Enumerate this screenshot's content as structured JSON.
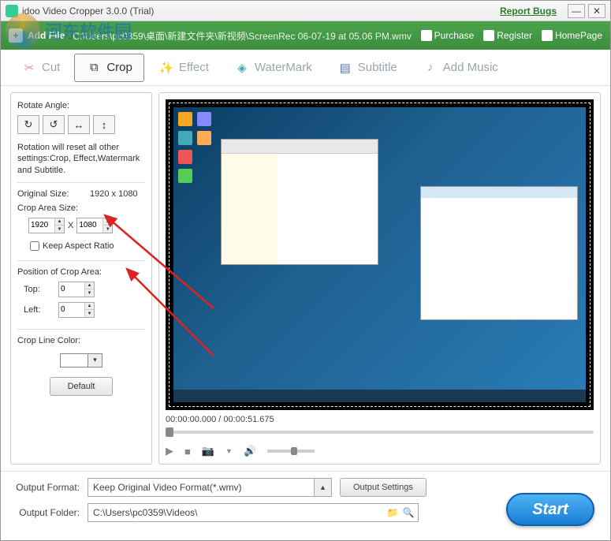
{
  "titlebar": {
    "app_title": "idoo Video Cropper 3.0.0 (Trial)",
    "report_bugs": "Report Bugs"
  },
  "addfile": {
    "add_label": "Add File",
    "path": "C:\\Users\\pc0359\\桌面\\新建文件夹\\新视频\\ScreenRec 06-07-19 at 05.06 PM.wmv",
    "purchase": "Purchase",
    "register": "Register",
    "homepage": "HomePage"
  },
  "tabs": {
    "cut": "Cut",
    "crop": "Crop",
    "effect": "Effect",
    "watermark": "WaterMark",
    "subtitle": "Subtitle",
    "addmusic": "Add Music"
  },
  "sidebar": {
    "rotate_label": "Rotate Angle:",
    "rotate_note": "Rotation will reset all other settings:Crop, Effect,Watermark and Subtitle.",
    "original_size_label": "Original Size:",
    "original_size_value": "1920 x 1080",
    "crop_area_label": "Crop Area Size:",
    "crop_w": "1920",
    "crop_h": "1080",
    "x_sep": "X",
    "keep_aspect": "Keep Aspect Ratio",
    "position_label": "Position of Crop Area:",
    "top_label": "Top:",
    "top_value": "0",
    "left_label": "Left:",
    "left_value": "0",
    "crop_line_label": "Crop Line Color:",
    "default_btn": "Default"
  },
  "preview": {
    "time_current": "00:00:00.000",
    "time_total": "00:00:51.675"
  },
  "bottom": {
    "format_label": "Output Format:",
    "format_value": "Keep Original Video Format(*.wmv)",
    "output_settings": "Output Settings",
    "folder_label": "Output Folder:",
    "folder_value": "C:\\Users\\pc0359\\Videos\\",
    "start": "Start"
  },
  "watermark_text": "河东软件园"
}
